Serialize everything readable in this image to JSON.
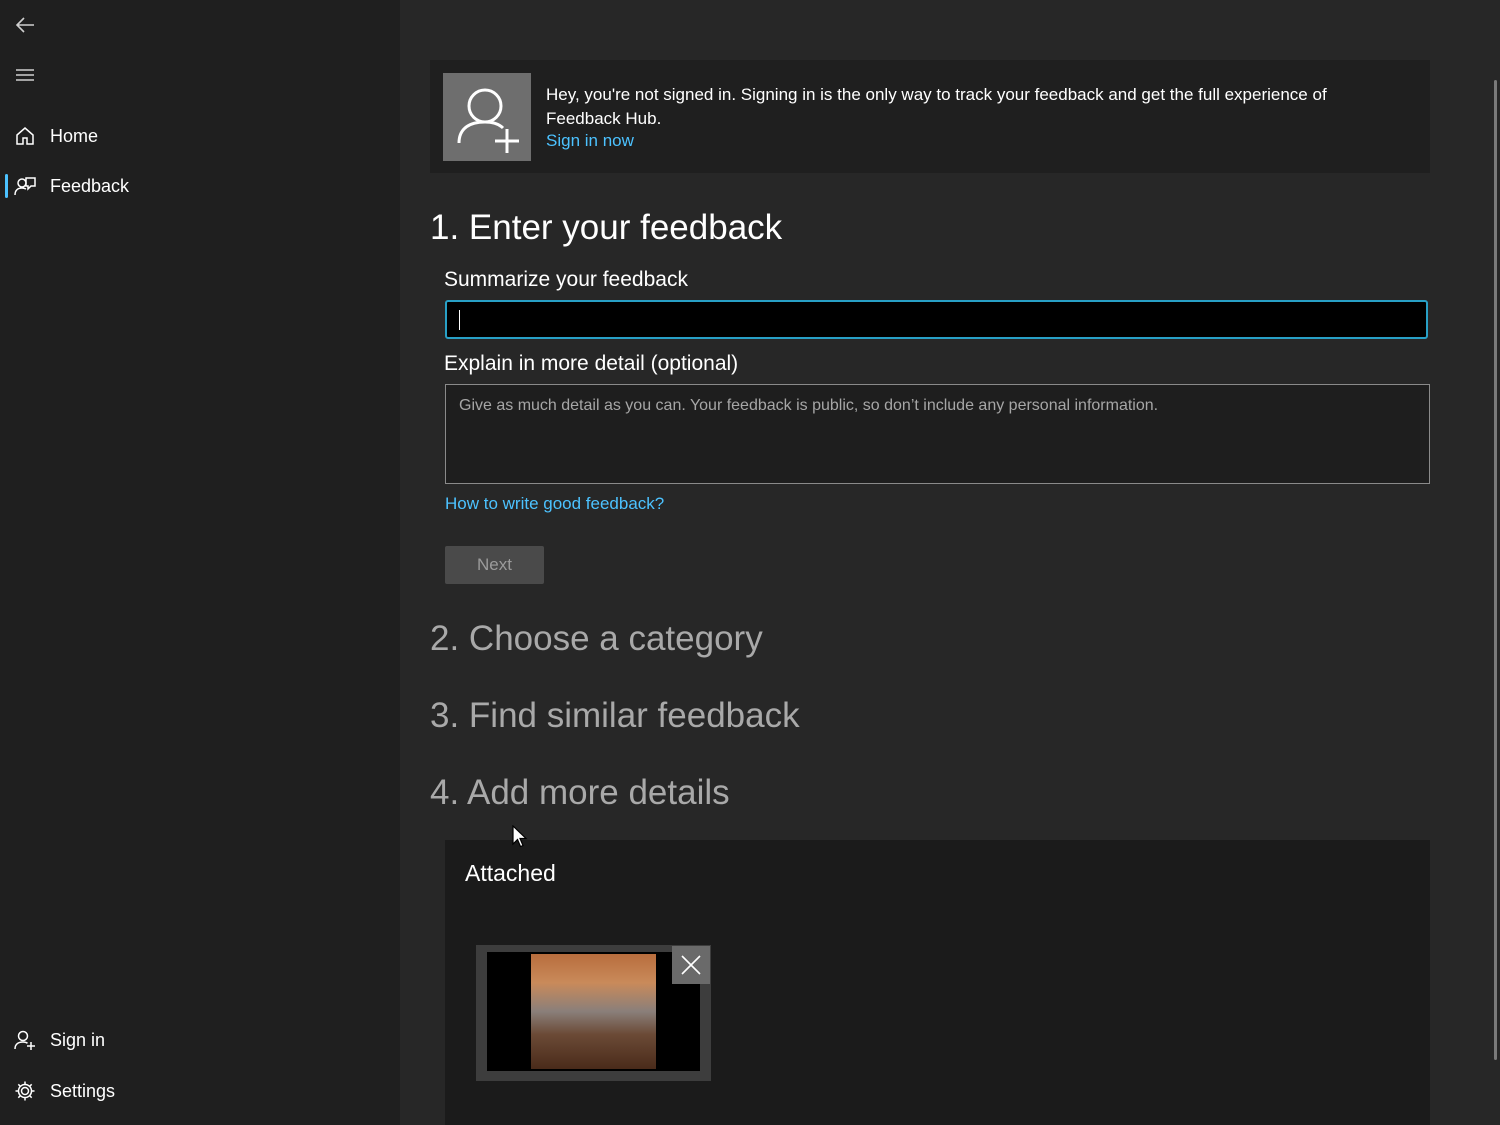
{
  "sidebar": {
    "items": [
      {
        "label": "Home",
        "icon": "home-icon"
      },
      {
        "label": "Feedback",
        "icon": "feedback-icon",
        "selected": true
      }
    ],
    "footer_items": [
      {
        "label": "Sign in",
        "icon": "person-icon"
      },
      {
        "label": "Settings",
        "icon": "gear-icon"
      }
    ]
  },
  "banner": {
    "text": "Hey, you're not signed in. Signing in is the only way to track your feedback and get the full experience of Feedback Hub.",
    "link": "Sign in now"
  },
  "steps": {
    "step1": "1. Enter your feedback",
    "step2": "2. Choose a category",
    "step3": "3. Find similar feedback",
    "step4": "4. Add more details"
  },
  "form": {
    "summary_label": "Summarize your feedback",
    "summary_value": "",
    "detail_label": "Explain in more detail (optional)",
    "detail_placeholder": "Give as much detail as you can. Your feedback is public, so don’t include any personal information.",
    "help_link": "How to write good feedback?",
    "next_button": "Next"
  },
  "attachments": {
    "title": "Attached"
  },
  "colors": {
    "accent": "#4cc2ff",
    "focus_border": "#28a0c6",
    "background": "#272727",
    "sidebar": "#1f1f1f"
  }
}
